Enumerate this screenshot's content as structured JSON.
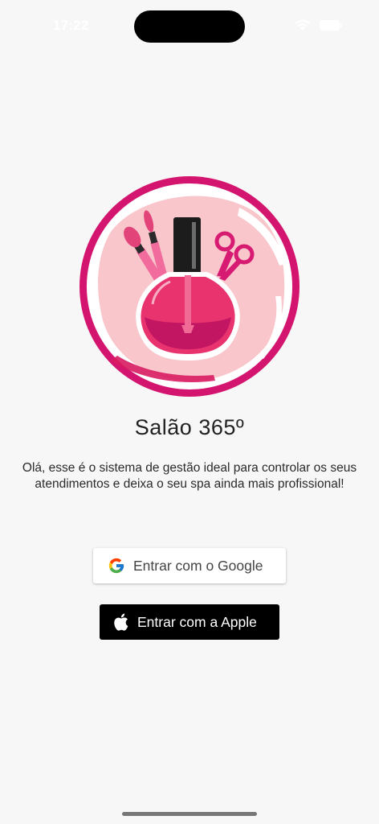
{
  "status_bar": {
    "time": "17:22",
    "wifi_icon": "wifi-icon",
    "battery_icon": "battery-icon"
  },
  "logo": {
    "icon": "salon-logo-nail-polish-brushes-scissors",
    "colors": {
      "ring": "#d81b72",
      "fill": "#f9c6cc",
      "bottle": "#e6336f"
    }
  },
  "app": {
    "title": "Salão 365º",
    "description": "Olá, esse é o sistema de gestão ideal para controlar os seus atendimentos e deixa o seu spa ainda mais profissional!"
  },
  "buttons": {
    "google": {
      "label": "Entrar com o Google",
      "icon": "google-icon"
    },
    "apple": {
      "label": "Entrar com a Apple",
      "icon": "apple-icon"
    }
  }
}
